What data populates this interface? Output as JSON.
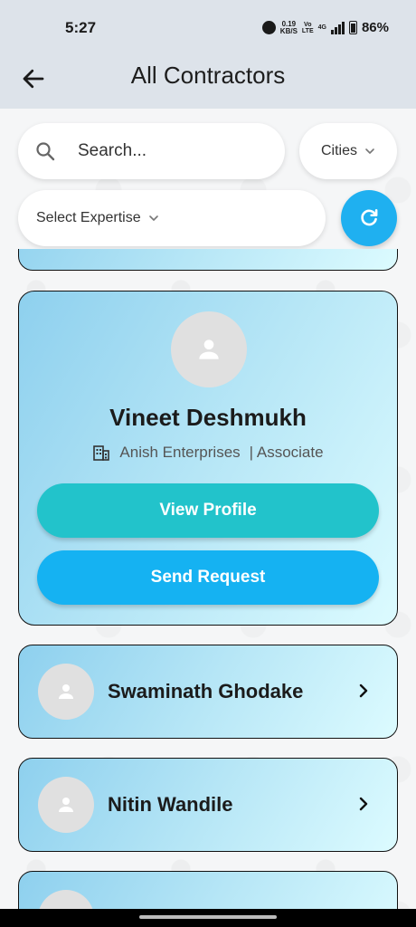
{
  "status_bar": {
    "time": "5:27",
    "speed_value": "0.19",
    "speed_unit": "KB/S",
    "volte_top": "Vo",
    "volte_bottom": "LTE",
    "network": "4G",
    "battery": "86%"
  },
  "header": {
    "title": "All Contractors",
    "back_icon": "arrow-left-icon"
  },
  "filters": {
    "search_placeholder": "Search...",
    "cities_label": "Cities",
    "expertise_label": "Select Expertise",
    "refresh_icon": "refresh-icon",
    "accent": "#1fb0f0"
  },
  "featured_contractor": {
    "name": "Vineet Deshmukh",
    "company": "Anish Enterprises",
    "role": "| Associate",
    "view_profile_label": "View Profile",
    "send_request_label": "Send Request",
    "view_profile_color": "#22c3cb",
    "send_request_color": "#15b2f2"
  },
  "contractors": [
    {
      "name": "Swaminath Ghodake"
    },
    {
      "name": "Nitin Wandile"
    }
  ]
}
